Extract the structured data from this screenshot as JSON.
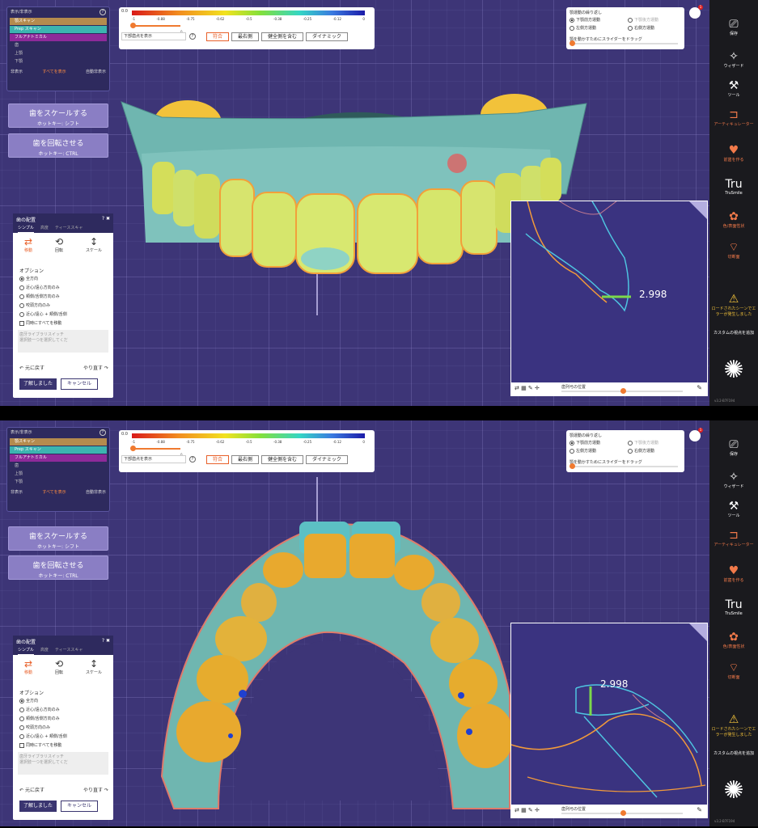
{
  "visibility": {
    "title": "表示/非表示",
    "rows": [
      "顎スキャン",
      "Prep スキャン",
      "フルアナトミカル"
    ],
    "group": "歯",
    "sub": [
      "上顎",
      "下顎"
    ],
    "hide_label": "非表示",
    "show_all": "すべてを表示",
    "auto_hide": "自動非表示"
  },
  "scale_button": {
    "title": "歯をスケールする",
    "hotkey": "ホットキー: シフト"
  },
  "rotate_button": {
    "title": "歯を回転させる",
    "hotkey": "ホットキー: CTRL"
  },
  "color_scale": {
    "top_label": "0.0",
    "ticks": [
      "-1",
      "-0.88",
      "-0.75",
      "-0.62",
      "-0.5",
      "-0.38",
      "-0.25",
      "-0.12",
      "0"
    ],
    "zero": "0",
    "select_value": "下部歯点を表示",
    "help": "?",
    "buttons": [
      "符合",
      "最右側",
      "健全側を含む",
      "ダイナミック"
    ],
    "more": "▾"
  },
  "movement": {
    "title": "顎運動の繰り返し",
    "opts": [
      "下顎前方運動",
      "下顎後方運動",
      "左側方運動",
      "右側方運動"
    ],
    "hint": "顎を動かすためにスライダーをドラッグ"
  },
  "notification": {
    "count": "1"
  },
  "toolbar": {
    "items": [
      {
        "icon": "save-icon",
        "glyph": "⎚",
        "label": "保存"
      },
      {
        "icon": "wand-icon",
        "glyph": "✧",
        "label": "ウィザード"
      },
      {
        "icon": "tools-icon",
        "glyph": "⚒",
        "label": "ツール"
      },
      {
        "icon": "articulator-icon",
        "glyph": "⊐",
        "label": "アーティキュレーター"
      },
      {
        "icon": "tooth-design-icon",
        "glyph": "♥",
        "label": "前歯を作る"
      },
      {
        "icon": "trusmile-icon",
        "glyph": "Tru",
        "label": "TruSmile"
      },
      {
        "icon": "color-icon",
        "glyph": "✿",
        "label": "色/表面性状"
      },
      {
        "icon": "cut-icon",
        "glyph": "⌔",
        "label": "切断面"
      }
    ],
    "warning": "ロードされたシーンでエラーが発生しました",
    "custom": "カスタムの視点を追加",
    "version": "v3.2-B7F194"
  },
  "tooth_placement": {
    "title": "歯の配置",
    "help": "?",
    "close": "✖",
    "tabs": [
      "シンプル",
      "高度",
      "ティーススキャ"
    ],
    "modes": [
      "移動",
      "回転",
      "スケール"
    ],
    "options_title": "オプション",
    "options": [
      "全方向",
      "近心/遠心方向のみ",
      "頬側/舌側方向のみ",
      "咬頭方向のみ",
      "近心/遠心 + 頬側/舌側",
      "同時にすべてを移動"
    ],
    "library": "歯牙ライブラリスイッチ",
    "library_hint": "選択肢一つを選択してくだ",
    "undo": "元に戻す",
    "redo": "やり直す",
    "ok": "了解しました",
    "cancel": "キャンセル"
  },
  "section": {
    "measure_top": "2.998",
    "measure_bottom": "2.998",
    "slider_label": "歯列弓の位置",
    "axis_unit": "mm"
  }
}
